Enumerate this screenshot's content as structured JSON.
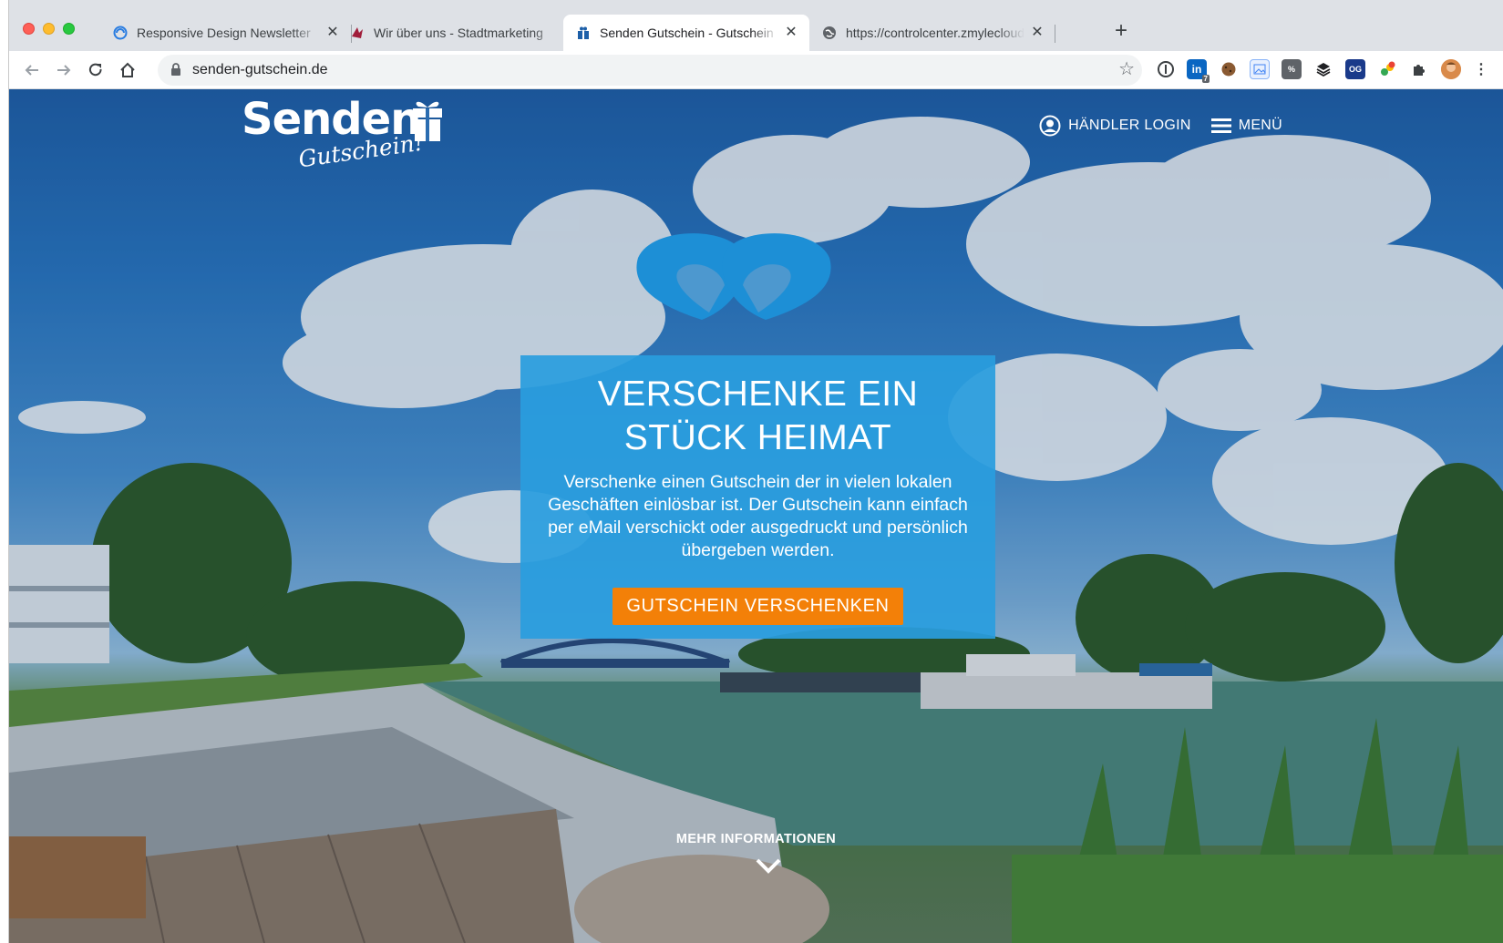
{
  "browser": {
    "tabs": [
      {
        "title": "Responsive Design Newsletter",
        "active": false,
        "favicon": "swirl-icon"
      },
      {
        "title": "Wir über uns - Stadtmarketing",
        "active": false,
        "favicon": "logo-icon"
      },
      {
        "title": "Senden Gutschein - Gutschein",
        "active": true,
        "favicon": "gift-icon"
      },
      {
        "title": "https://controlcenter.zmylecloud",
        "active": false,
        "favicon": "globe-icon"
      }
    ],
    "url": "senden-gutschein.de",
    "extensions": [
      "1password-icon",
      "linkedin-icon",
      "cookie-icon",
      "image-icon",
      "extension-icon",
      "layers-icon",
      "og-icon",
      "notification-icon",
      "puzzle-icon",
      "profile-avatar",
      "more-icon"
    ],
    "linkedin_badge": "7",
    "og_label": "OG"
  },
  "site": {
    "logo_word": "Senden",
    "logo_sub": "Gutschein!",
    "dealer_login": "HÄNDLER LOGIN",
    "menu": "MENÜ",
    "hero_title_line1": "VERSCHENKE EIN",
    "hero_title_line2": "STÜCK HEIMAT",
    "hero_text": "Verschenke einen Gutschein der in vielen lokalen Geschäften einlösbar ist. Der Gutschein kann einfach per eMail verschickt oder ausgedruckt und persönlich übergeben werden.",
    "cta": "GUTSCHEIN VERSCHENKEN",
    "more_info": "MEHR INFORMATIONEN"
  },
  "colors": {
    "accent_blue": "#299dde",
    "cta_orange": "#f38008"
  }
}
